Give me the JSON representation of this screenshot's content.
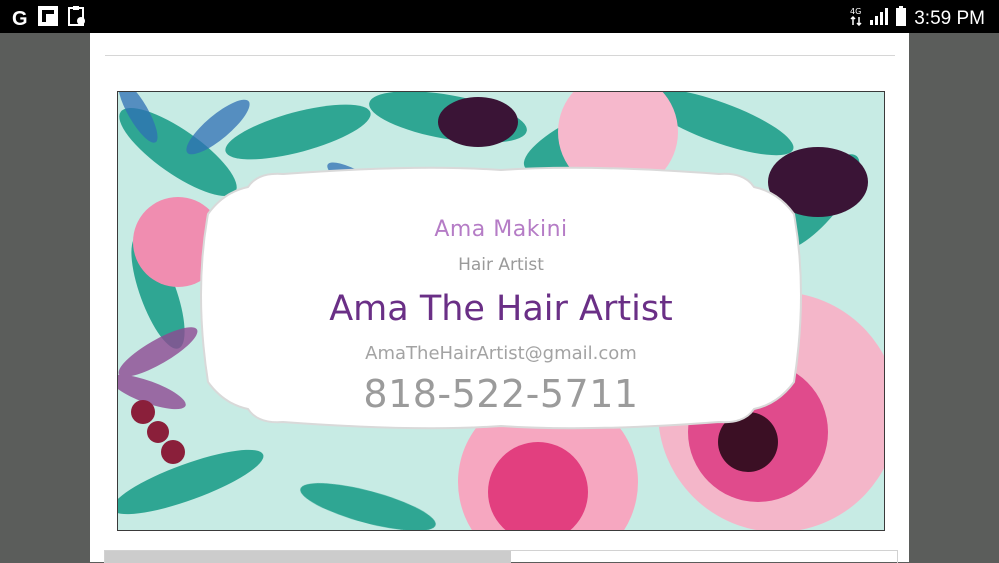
{
  "status_bar": {
    "time": "3:59 PM",
    "left_icons": [
      "google-g-icon",
      "flipboard-icon",
      "clipboard-icon"
    ],
    "right_icons": [
      "data-transfer-icon",
      "signal-icon",
      "battery-icon"
    ],
    "google_letter": "G"
  },
  "card": {
    "name": "Ama Makini",
    "role": "Hair Artist",
    "business": "Ama The Hair Artist",
    "email": "AmaTheHairArtist@gmail.com",
    "phone": "818-522-5711"
  },
  "colors": {
    "name": "#b57cc6",
    "business": "#6a2f86",
    "muted": "#9b9b9b",
    "leaf_teal": "#1f9f8a",
    "flower_pink": "#e04b8c"
  }
}
